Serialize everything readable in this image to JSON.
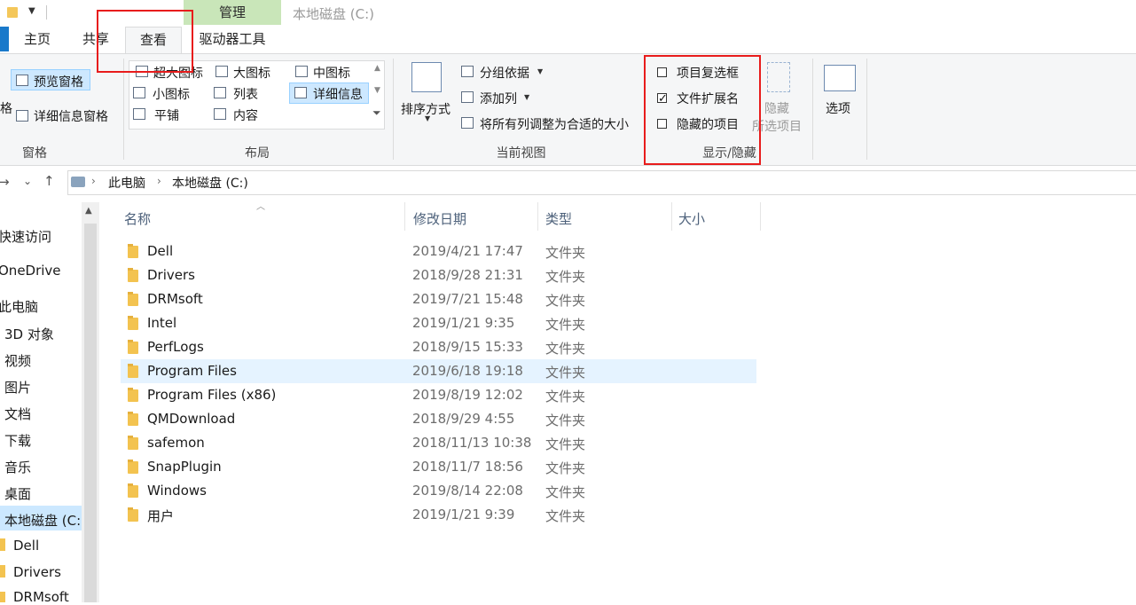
{
  "window": {
    "title": "本地磁盘 (C:)"
  },
  "context_tab": {
    "label": "管理"
  },
  "tabs": [
    {
      "label": "主页"
    },
    {
      "label": "共享"
    },
    {
      "label": "查看"
    },
    {
      "label": "驱动器工具"
    }
  ],
  "ribbon": {
    "panes": {
      "preview": "预览窗格",
      "details": "详细信息窗格",
      "edge": "格",
      "group": "窗格"
    },
    "layout": {
      "items": [
        "超大图标",
        "大图标",
        "中图标",
        "小图标",
        "列表",
        "详细信息",
        "平铺",
        "内容"
      ],
      "group": "布局"
    },
    "current_view": {
      "sort": "排序方式",
      "group_by": "分组依据",
      "add_column": "添加列",
      "fit_columns": "将所有列调整为合适的大小",
      "group": "当前视图"
    },
    "show_hide": {
      "item_checkboxes": "项目复选框",
      "file_extensions": "文件扩展名",
      "hidden_items": "隐藏的项目",
      "hide_selected_1": "隐藏",
      "hide_selected_2": "所选项目",
      "group": "显示/隐藏",
      "checked": {
        "item_checkboxes": false,
        "file_extensions": true,
        "hidden_items": false
      }
    },
    "options": {
      "label": "选项"
    }
  },
  "address": {
    "crumbs": [
      "此电脑",
      "本地磁盘 (C:)"
    ]
  },
  "sidebar": {
    "items": [
      "快速访问",
      "OneDrive",
      "此电脑",
      "3D 对象",
      "视频",
      "图片",
      "文档",
      "下载",
      "音乐",
      "桌面",
      "本地磁盘 (C:)",
      "Dell",
      "Drivers",
      "DRMsoft"
    ]
  },
  "columns": {
    "name": "名称",
    "date": "修改日期",
    "type": "类型",
    "size": "大小"
  },
  "files": [
    {
      "name": "Dell",
      "date": "2019/4/21 17:47",
      "type": "文件夹"
    },
    {
      "name": "Drivers",
      "date": "2018/9/28 21:31",
      "type": "文件夹"
    },
    {
      "name": "DRMsoft",
      "date": "2019/7/21 15:48",
      "type": "文件夹"
    },
    {
      "name": "Intel",
      "date": "2019/1/21 9:35",
      "type": "文件夹"
    },
    {
      "name": "PerfLogs",
      "date": "2018/9/15 15:33",
      "type": "文件夹"
    },
    {
      "name": "Program Files",
      "date": "2019/6/18 19:18",
      "type": "文件夹"
    },
    {
      "name": "Program Files (x86)",
      "date": "2019/8/19 12:02",
      "type": "文件夹"
    },
    {
      "name": "QMDownload",
      "date": "2018/9/29 4:55",
      "type": "文件夹"
    },
    {
      "name": "safemon",
      "date": "2018/11/13 10:38",
      "type": "文件夹"
    },
    {
      "name": "SnapPlugin",
      "date": "2018/11/7 18:56",
      "type": "文件夹"
    },
    {
      "name": "Windows",
      "date": "2019/8/14 22:08",
      "type": "文件夹"
    },
    {
      "name": "用户",
      "date": "2019/1/21 9:39",
      "type": "文件夹"
    }
  ],
  "colors": {
    "accent": "#1979ca",
    "manage_tab": "#c9e6b9",
    "selection": "#cce8ff",
    "annotation": "#e81c1c"
  }
}
